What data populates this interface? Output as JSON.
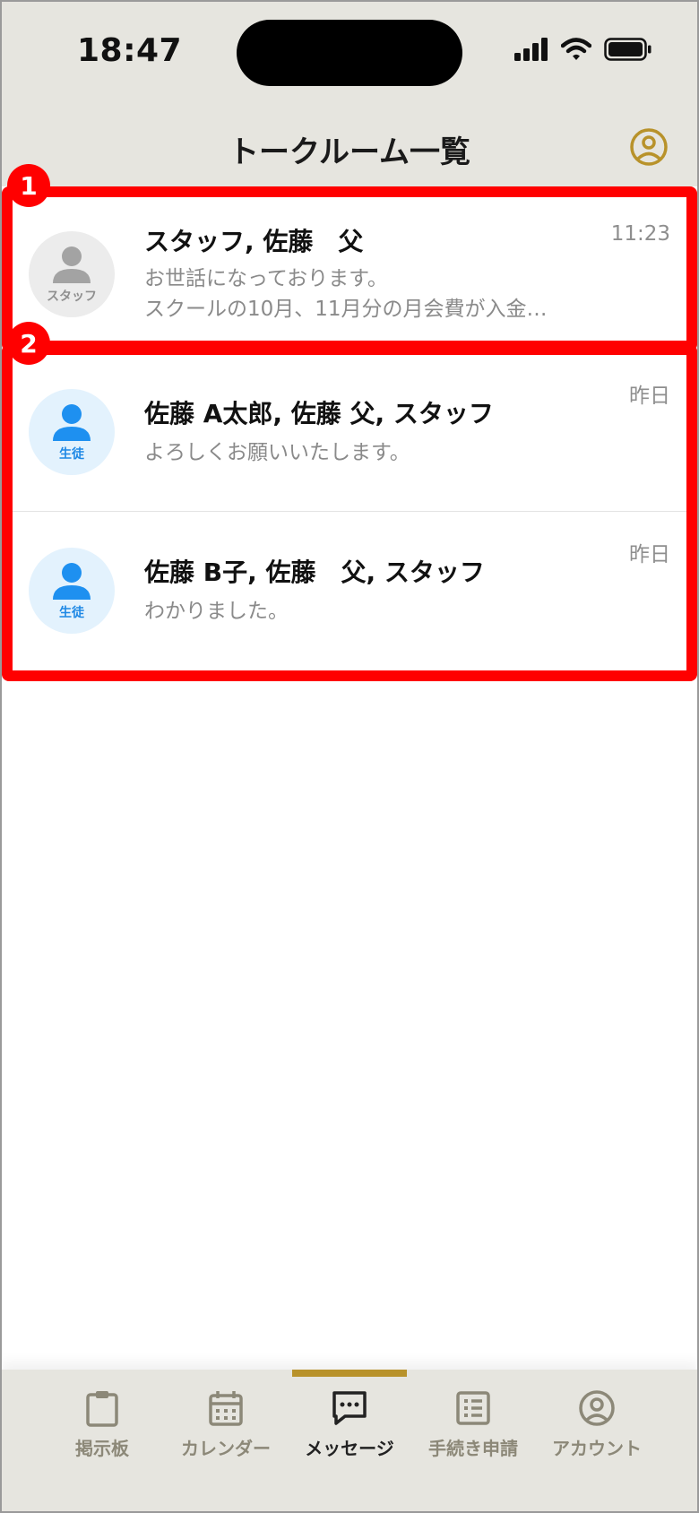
{
  "status_bar": {
    "time": "18:47"
  },
  "header": {
    "title": "トークルーム一覧",
    "account_icon": "person-circle-icon",
    "accent_color": "#b8922a"
  },
  "rooms": [
    {
      "name": "スタッフ, 佐藤　父",
      "message_line1": "お世話になっております。",
      "message_line2": "スクールの10月、11月分の月会費が入金…",
      "time": "11:23",
      "avatar_label": "スタッフ",
      "avatar_type": "staff"
    },
    {
      "name": "佐藤 A太郎, 佐藤 父, スタッフ",
      "message_line1": "よろしくお願いいたします。",
      "time": "昨日",
      "avatar_label": "生徒",
      "avatar_type": "student"
    },
    {
      "name": "佐藤 B子, 佐藤　父, スタッフ",
      "message_line1": "わかりました。",
      "time": "昨日",
      "avatar_label": "生徒",
      "avatar_type": "student"
    }
  ],
  "annotations": [
    {
      "label": "1",
      "color": "#ff0000"
    },
    {
      "label": "2",
      "color": "#ff0000"
    }
  ],
  "tabs": [
    {
      "label": "掲示板",
      "icon": "clipboard-icon",
      "active": false
    },
    {
      "label": "カレンダー",
      "icon": "calendar-icon",
      "active": false
    },
    {
      "label": "メッセージ",
      "icon": "chat-bubble-icon",
      "active": true
    },
    {
      "label": "手続き申請",
      "icon": "form-list-icon",
      "active": false
    },
    {
      "label": "アカウント",
      "icon": "account-circle-icon",
      "active": false
    }
  ]
}
